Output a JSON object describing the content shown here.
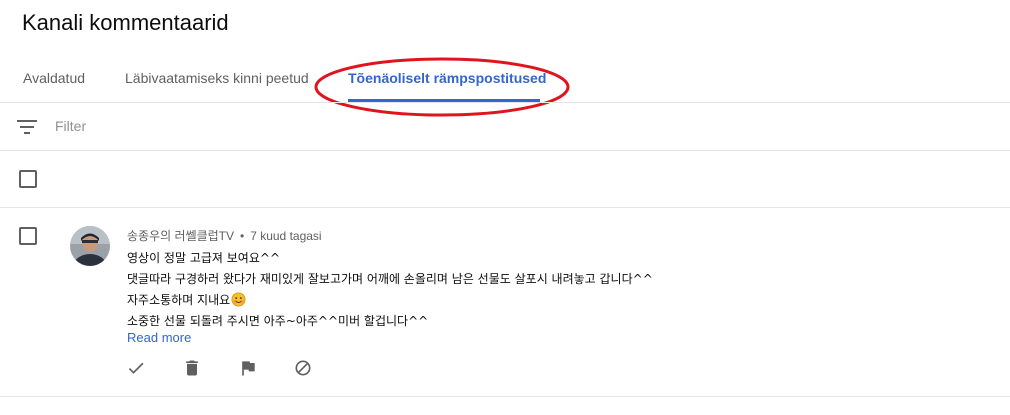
{
  "page": {
    "title": "Kanali kommentaarid"
  },
  "tabs": [
    {
      "label": "Avaldatud",
      "active": false
    },
    {
      "label": "Läbivaatamiseks kinni peetud",
      "active": false
    },
    {
      "label": "Tõenäoliselt rämpspostitused",
      "active": true
    }
  ],
  "filter": {
    "placeholder": "Filter",
    "value": "",
    "icon": "filter-lines-icon"
  },
  "select_all": {
    "checked": false
  },
  "comments": [
    {
      "author": "송종우의 러쎌클럽TV",
      "time": "7 kuud tagasi",
      "lines": [
        "영상이 정말 고급져 보여요^^",
        "댓글따라 구경하러 왔다가 재미있게 잘보고가며 어깨에  손올리며 남은 선물도 살포시 내려놓고 갑니다^^",
        "자주소통하며 지내요",
        "소중한 선물 되돌려 주시면 아주~아주^^미버 할겁니다^^"
      ],
      "emoji_after_line_3": "smiling-face-emoji",
      "read_more": "Read more",
      "actions": [
        "check-icon",
        "trash-icon",
        "flag-icon",
        "block-icon"
      ]
    }
  ],
  "colors": {
    "accent": "#3366cc",
    "annotation": "#e0141e",
    "text": "#0d0d0d",
    "secondary": "#606060",
    "divider": "#e5e5e5"
  }
}
